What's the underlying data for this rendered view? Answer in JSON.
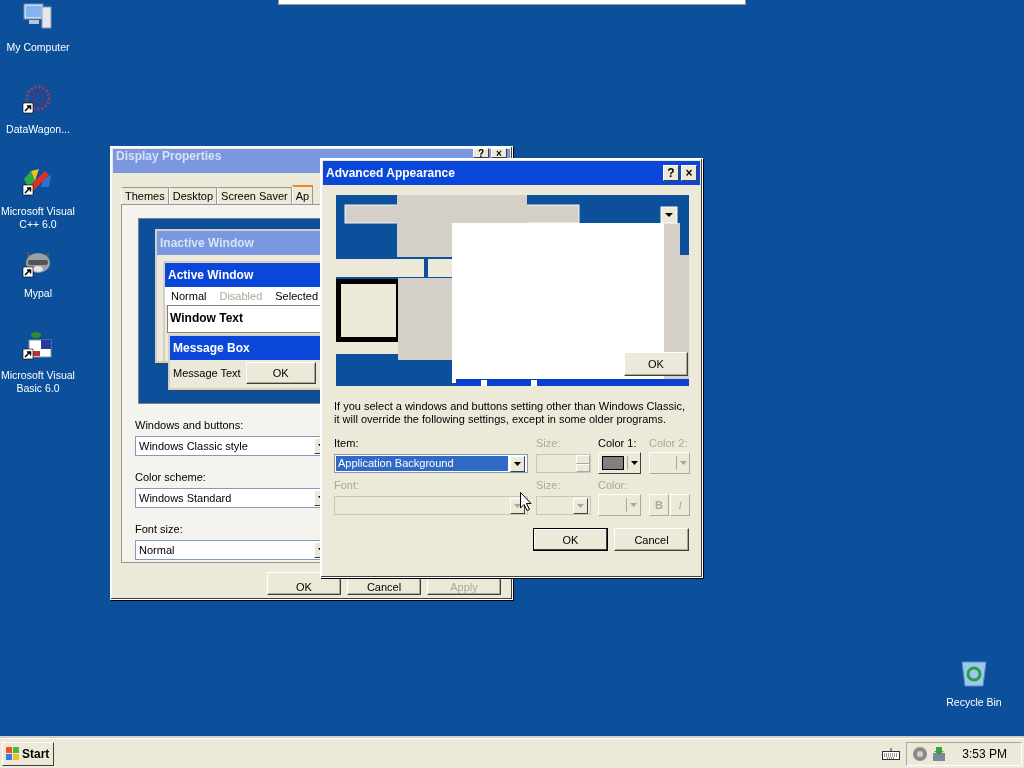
{
  "desktop": {
    "icons": [
      {
        "label": "My Computer",
        "kind": "computer",
        "shortcut": false
      },
      {
        "label": "DataWagon...",
        "kind": "globe",
        "shortcut": true
      },
      {
        "label": "Microsoft Visual C++ 6.0",
        "kind": "compiler",
        "shortcut": true
      },
      {
        "label": "Mypal",
        "kind": "animal",
        "shortcut": true
      },
      {
        "label": "Microsoft Visual Basic 6.0",
        "kind": "basic",
        "shortcut": true
      }
    ],
    "corner_icons": [
      {
        "label": "Recycle Bin",
        "kind": "recycle-bin",
        "shortcut": false
      }
    ]
  },
  "display_properties": {
    "title": "Display Properties",
    "active": false,
    "title_buttons": [
      "?",
      "×"
    ],
    "tabs": [
      {
        "label": "Themes",
        "selected": false
      },
      {
        "label": "Desktop",
        "selected": false
      },
      {
        "label": "Screen Saver",
        "selected": false
      },
      {
        "label": "Ap",
        "selected": true
      }
    ],
    "preview": {
      "inactive_title": "Inactive Window",
      "active_title": "Active Window",
      "menu": [
        {
          "label": "Normal",
          "disabled": false
        },
        {
          "label": "Disabled",
          "disabled": true
        },
        {
          "label": "Selected",
          "disabled": false
        }
      ],
      "window_text": "Window Text",
      "message_title": "Message Box",
      "message_text": "Message Text",
      "message_button": "OK"
    },
    "fields": [
      {
        "label": "Windows and buttons:",
        "value": "Windows Classic style"
      },
      {
        "label": "Color scheme:",
        "value": "Windows Standard"
      },
      {
        "label": "Font size:",
        "value": "Normal"
      }
    ],
    "buttons": [
      {
        "label": "OK",
        "disabled": false
      },
      {
        "label": "Cancel",
        "disabled": false
      },
      {
        "label": "Apply",
        "disabled": true
      }
    ]
  },
  "advanced_appearance": {
    "title": "Advanced Appearance",
    "active": true,
    "title_buttons": [
      "?",
      "×"
    ],
    "preview": {
      "button": "OK"
    },
    "note": "If you select a windows and buttons setting other than Windows Classic, it will override the following settings, except in some older programs.",
    "item_row": [
      {
        "label": "Item:",
        "kind": "dropdown",
        "value": "Application Background",
        "focused": true,
        "disabled": false
      },
      {
        "label": "Size:",
        "kind": "spinner",
        "disabled": true
      },
      {
        "label": "Color 1:",
        "kind": "color",
        "color": "#808080",
        "disabled": false
      },
      {
        "label": "Color 2:",
        "kind": "color",
        "disabled": true
      }
    ],
    "font_row": [
      {
        "label": "Font:",
        "kind": "dropdown",
        "disabled": true
      },
      {
        "label": "Size:",
        "kind": "dropdown",
        "disabled": true
      },
      {
        "label": "Color:",
        "kind": "color",
        "disabled": true
      },
      {
        "kind": "toggles",
        "toggles": [
          {
            "label": "B",
            "disabled": true
          },
          {
            "label": "I",
            "disabled": true
          }
        ]
      }
    ],
    "buttons": [
      {
        "label": "OK",
        "default": true
      },
      {
        "label": "Cancel",
        "default": false
      }
    ]
  },
  "taskbar": {
    "start": "Start",
    "clock": "3:53 PM"
  }
}
